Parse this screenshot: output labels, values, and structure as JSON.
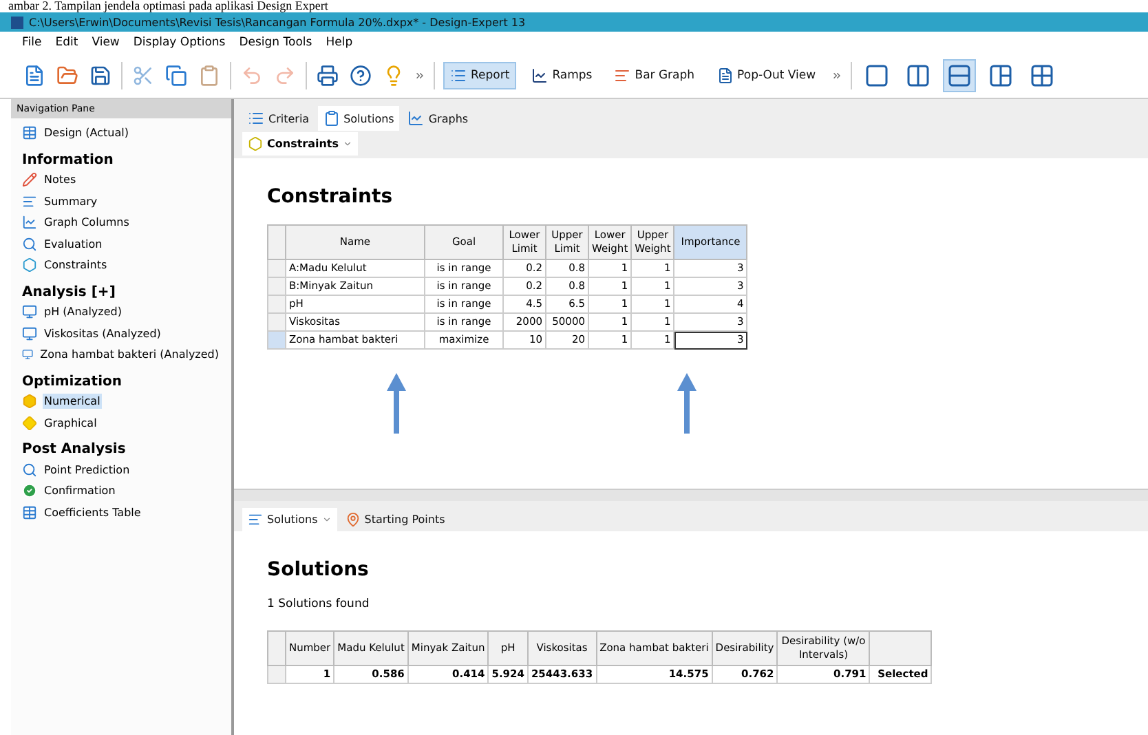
{
  "caption": "ambar 2. Tampilan jendela optimasi pada aplikasi Design Expert",
  "window": {
    "title": "C:\\Users\\Erwin\\Documents\\Revisi Tesis\\Rancangan Formula 20%.dxpx* - Design-Expert 13"
  },
  "menu": [
    "File",
    "Edit",
    "View",
    "Display Options",
    "Design Tools",
    "Help"
  ],
  "toolbar": {
    "views": [
      {
        "label": "Report",
        "selected": true
      },
      {
        "label": "Ramps",
        "selected": false
      },
      {
        "label": "Bar Graph",
        "selected": false
      },
      {
        "label": "Pop-Out View",
        "selected": false
      }
    ],
    "layouts": [
      {
        "kind": "single",
        "selected": false
      },
      {
        "kind": "columns",
        "selected": false
      },
      {
        "kind": "rows",
        "selected": true
      },
      {
        "kind": "three",
        "selected": false
      },
      {
        "kind": "quad",
        "selected": false
      }
    ]
  },
  "navigation": {
    "title": "Navigation Pane",
    "sections": [
      {
        "items": [
          {
            "label": "Design (Actual)",
            "kind": "table",
            "selected": false
          }
        ]
      },
      {
        "heading": "Information",
        "items": [
          {
            "label": "Notes",
            "kind": "pencil",
            "selected": false
          },
          {
            "label": "Summary",
            "kind": "lines",
            "selected": false
          },
          {
            "label": "Graph Columns",
            "kind": "graph",
            "selected": false
          },
          {
            "label": "Evaluation",
            "kind": "search",
            "selected": false
          },
          {
            "label": "Constraints",
            "kind": "shape",
            "selected": false
          }
        ]
      },
      {
        "heading": "Analysis [+]",
        "items": [
          {
            "label": "pH (Analyzed)",
            "kind": "monitor",
            "selected": false
          },
          {
            "label": "Viskositas (Analyzed)",
            "kind": "monitor",
            "selected": false
          },
          {
            "label": "Zona hambat bakteri (Analyzed)",
            "kind": "monitor",
            "selected": false
          }
        ]
      },
      {
        "heading": "Optimization",
        "items": [
          {
            "label": "Numerical",
            "kind": "hill",
            "selected": true
          },
          {
            "label": "Graphical",
            "kind": "diamond",
            "selected": false
          }
        ]
      },
      {
        "heading": "Post Analysis",
        "items": [
          {
            "label": "Point Prediction",
            "kind": "search",
            "selected": false
          },
          {
            "label": "Confirmation",
            "kind": "check",
            "selected": false
          },
          {
            "label": "Coefficients Table",
            "kind": "table",
            "selected": false
          }
        ]
      }
    ]
  },
  "tabs": [
    {
      "label": "Criteria",
      "selected": false
    },
    {
      "label": "Solutions",
      "selected": true
    },
    {
      "label": "Graphs",
      "selected": false
    }
  ],
  "constraints": {
    "subtab": "Constraints",
    "heading": "Constraints",
    "columns": [
      {
        "label": "Name",
        "selected": false
      },
      {
        "label": "Goal",
        "selected": false
      },
      {
        "label": "Lower Limit",
        "selected": false
      },
      {
        "label": "Upper Limit",
        "selected": false
      },
      {
        "label": "Lower Weight",
        "selected": false
      },
      {
        "label": "Upper Weight",
        "selected": false
      },
      {
        "label": "Importance",
        "selected": true
      }
    ],
    "rows": [
      {
        "cells": [
          "A:Madu Kelulut",
          "is in range",
          "0.2",
          "0.8",
          "1",
          "1",
          "3"
        ],
        "selected": false
      },
      {
        "cells": [
          "B:Minyak Zaitun",
          "is in range",
          "0.2",
          "0.8",
          "1",
          "1",
          "3"
        ],
        "selected": false
      },
      {
        "cells": [
          "pH",
          "is in range",
          "4.5",
          "6.5",
          "1",
          "1",
          "4"
        ],
        "selected": false
      },
      {
        "cells": [
          "Viskositas",
          "is in range",
          "2000",
          "50000",
          "1",
          "1",
          "3"
        ],
        "selected": false
      },
      {
        "cells": [
          "Zona hambat bakteri",
          "maximize",
          "10",
          "20",
          "1",
          "1",
          "3"
        ],
        "selected": true
      }
    ]
  },
  "lower_tabs": [
    {
      "label": "Solutions",
      "selected": true
    },
    {
      "label": "Starting Points",
      "selected": false
    }
  ],
  "solutions": {
    "heading": "Solutions",
    "found": "1 Solutions found",
    "columns": [
      "Number",
      "Madu Kelulut",
      "Minyak Zaitun",
      "pH",
      "Viskositas",
      "Zona hambat bakteri",
      "Desirability",
      "Desirability (w/o Intervals)",
      ""
    ],
    "rows": [
      [
        "1",
        "0.586",
        "0.414",
        "5.924",
        "25443.633",
        "14.575",
        "0.762",
        "0.791",
        "Selected"
      ]
    ]
  }
}
